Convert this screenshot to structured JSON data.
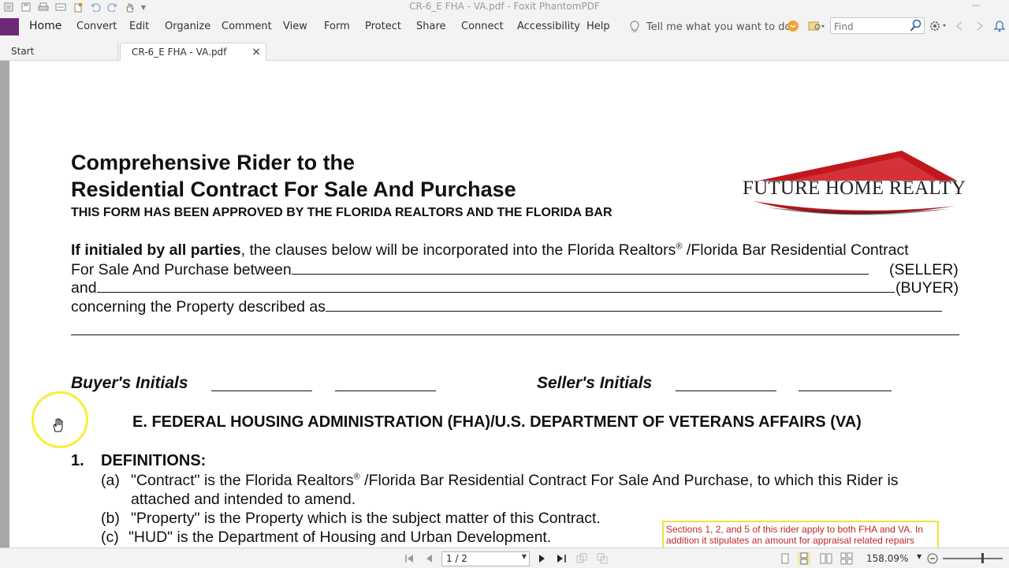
{
  "window": {
    "title": "CR-6_E FHA - VA.pdf - Foxit PhantomPDF"
  },
  "menu": {
    "items": [
      "Home",
      "Convert",
      "Edit",
      "Organize",
      "Comment",
      "View",
      "Form",
      "Protect",
      "Share",
      "Connect",
      "Accessibility",
      "Help"
    ],
    "tell_me": "Tell me what you want to do..",
    "find_placeholder": "Find"
  },
  "tabs": {
    "start": "Start",
    "document": "CR-6_E FHA - VA.pdf",
    "close": "×"
  },
  "document": {
    "title_line1": "Comprehensive Rider to the",
    "title_line2": "Residential Contract For Sale And Purchase",
    "approved": "THIS FORM HAS BEEN APPROVED BY THE FLORIDA REALTORS AND THE FLORIDA BAR",
    "logo_text": "FUTURE HOME REALTY",
    "intro_bold": "If initialed by all parties",
    "intro_rest_a": ", the clauses below will be incorporated into the Florida Realtors",
    "intro_reg": "®",
    "intro_rest_b": " /Florida Bar Residential Contract",
    "for_sale_between": "For Sale And Purchase between",
    "seller_tag": "(SELLER)",
    "and_word": "and",
    "buyer_tag": "(BUYER)",
    "concerning": "concerning the Property described as",
    "buyers_initials": "Buyer's Initials",
    "sellers_initials": "Seller's Initials",
    "section_heading": "E. FEDERAL HOUSING ADMINISTRATION (FHA)/U.S. DEPARTMENT OF VETERANS AFFAIRS (VA)",
    "def_number": "1.",
    "def_title": "DEFINITIONS:",
    "def_a_label": "(a)",
    "def_a_text1": "\"Contract\" is the Florida Realtors",
    "def_a_reg": "®",
    "def_a_text2": " /Florida Bar Residential Contract For Sale And Purchase, to which this Rider is",
    "def_a_line2": "attached and intended to amend.",
    "def_b_label": "(b)",
    "def_b_text": "\"Property\" is the Property which is the subject matter of this Contract.",
    "def_c_label": "(c)",
    "def_c_text": "\"HUD\" is the Department of Housing and Urban Development.",
    "note_text": "Sections 1, 2, and 5 of this rider apply to both FHA and VA. In addition it stipulates an amount for appraisal related repairs"
  },
  "status": {
    "page_display": "1 / 2",
    "zoom": "158.09%",
    "zoom_level_percent": 158.09
  },
  "colors": {
    "file_tab": "#6d2a77",
    "logo_roof": "#c0181e",
    "note_border": "#f0e23a",
    "note_text": "#c0282d",
    "cursor_ring": "#f7ef3c"
  }
}
